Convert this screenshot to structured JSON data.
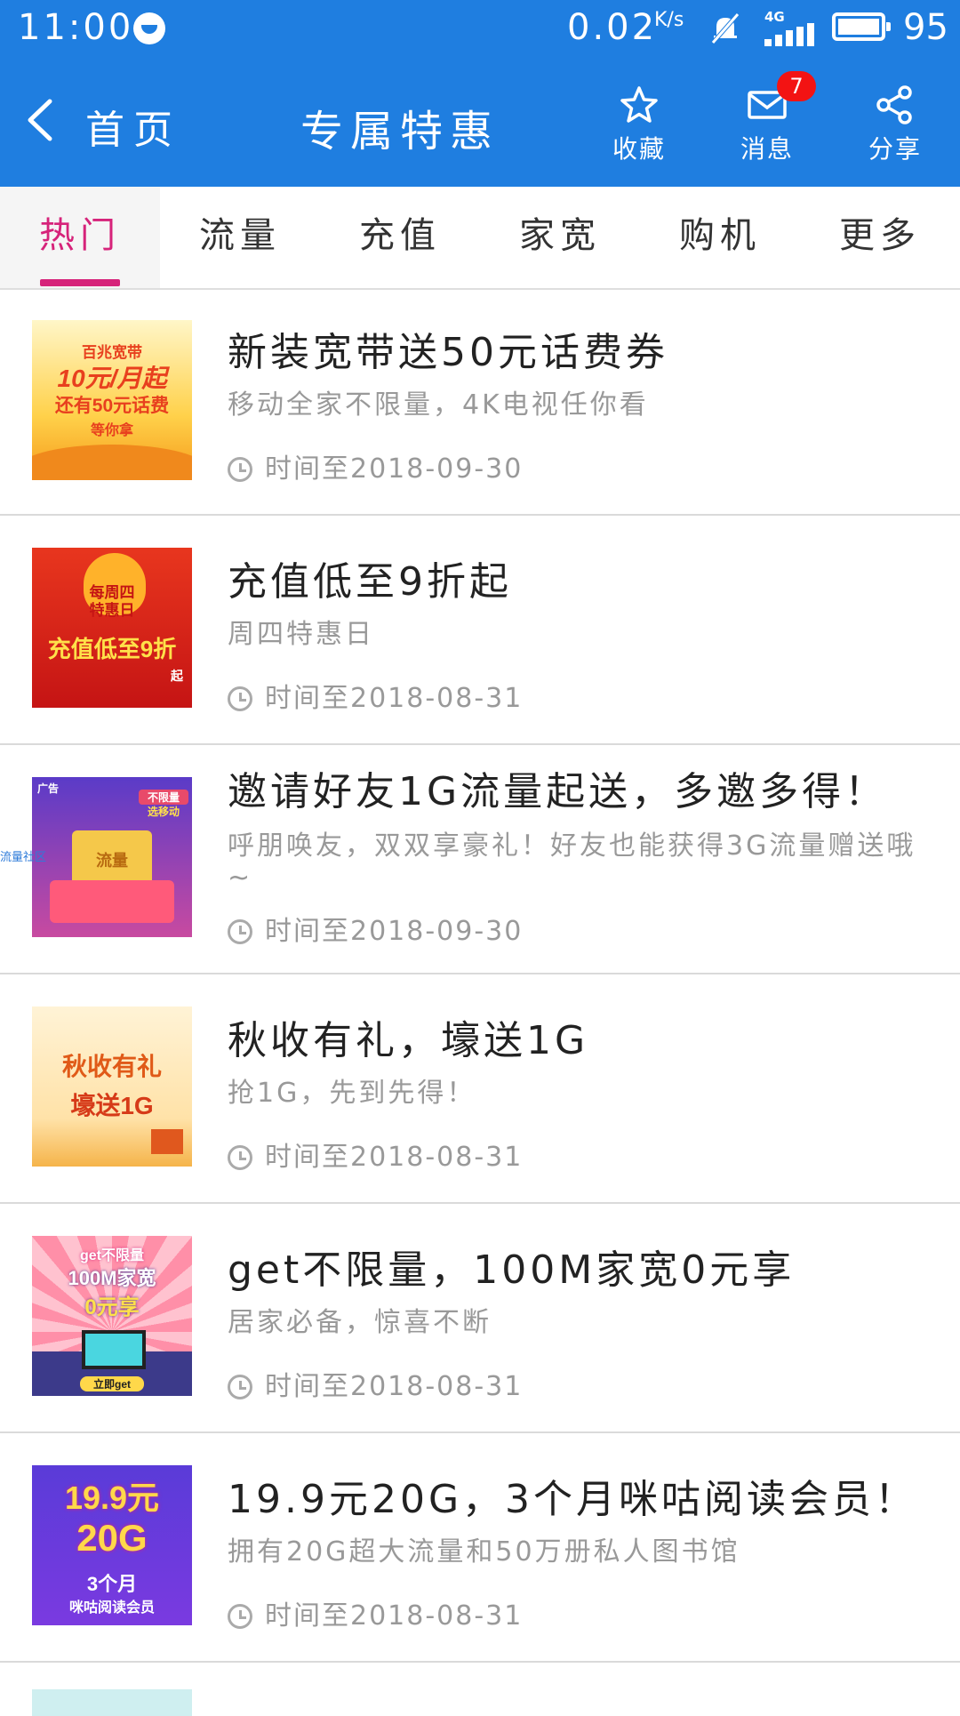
{
  "status_bar": {
    "time": "11:00",
    "speed": "0.02",
    "speed_unit": "K/s",
    "network": "4G",
    "battery": "95"
  },
  "header": {
    "back_label": "首页",
    "title": "专属特惠",
    "actions": {
      "favorite": "收藏",
      "messages": "消息",
      "messages_badge": "7",
      "share": "分享"
    }
  },
  "tabs": [
    "热门",
    "流量",
    "充值",
    "家宽",
    "购机",
    "更多"
  ],
  "active_tab": "热门",
  "items": [
    {
      "title": "新装宽带送50元话费券",
      "subtitle": "移动全家不限量，4K电视任你看",
      "date": "时间至2018-09-30",
      "thumb": {
        "l1": "百兆宽带",
        "l2": "10元/月起",
        "l3": "还有50元话费",
        "l4": "等你拿"
      }
    },
    {
      "title": "充值低至9折起",
      "subtitle": "周四特惠日",
      "date": "时间至2018-08-31",
      "thumb": {
        "l1": "每周四",
        "l2": "特惠日",
        "l3": "充值低至9折",
        "l4": "起"
      }
    },
    {
      "title": "邀请好友1G流量起送，多邀多得！",
      "subtitle": "呼朋唤友，双双享豪礼！好友也能获得3G流量赠送哦~",
      "date": "时间至2018-09-30",
      "thumb": {
        "l1": "广告",
        "l2": "不限量",
        "l3": "流量",
        "l4": "选移动"
      }
    },
    {
      "title": "秋收有礼，壕送1G",
      "subtitle": "抢1G，先到先得！",
      "date": "时间至2018-08-31",
      "thumb": {
        "l1": "秋收有礼",
        "l2": "壕送1G"
      }
    },
    {
      "title": "get不限量，100M家宽0元享",
      "subtitle": "居家必备，惊喜不断",
      "date": "时间至2018-08-31",
      "thumb": {
        "l1": "get不限量",
        "l2": "100M家宽",
        "l3": "0元享",
        "l4": "立即get"
      }
    },
    {
      "title": "19.9元20G，3个月咪咕阅读会员！",
      "subtitle": "拥有20G超大流量和50万册私人图书馆",
      "date": "时间至2018-08-31",
      "thumb": {
        "l1": "19.9元",
        "l2": "20G",
        "l3": "3个月",
        "l4": "咪咕阅读会员"
      }
    }
  ],
  "watermark": "流量社区",
  "colors": {
    "header_bg": "#1f7ee0",
    "active_tab": "#d6237a",
    "badge": "#f31313"
  }
}
